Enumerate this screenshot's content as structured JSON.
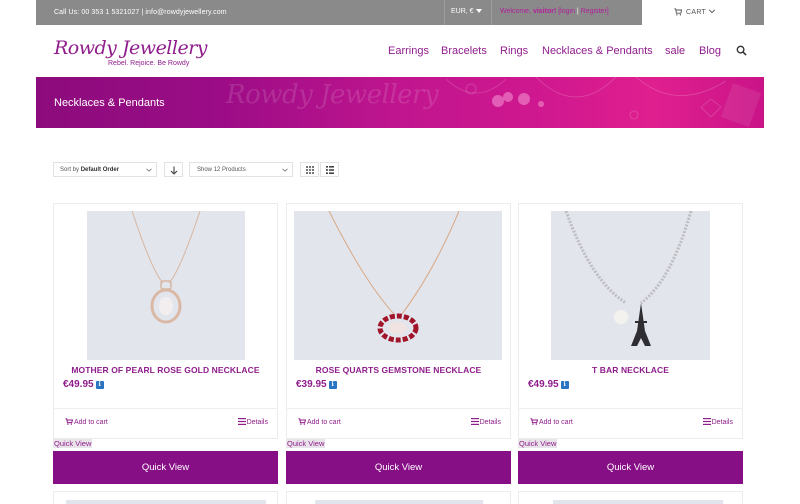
{
  "topbar": {
    "contact": "Call Us: 00 353 1 5321027  |  info@rowdyjewellery.com",
    "currency": "EUR, €",
    "welcome_prefix": "Welcome, ",
    "welcome_user": "visitor!",
    "login": "[login",
    "pipe": "|",
    "register": "Register]",
    "cart_label": "CART"
  },
  "header": {
    "logo_text": "Rowdy Jewellery",
    "tagline": "Rebel. Rejoice. Be Rowdy",
    "nav": [
      "Earrings",
      "Bracelets",
      "Rings",
      "Necklaces & Pendants",
      "sale",
      "Blog"
    ]
  },
  "banner": {
    "title": "Necklaces & Pendants",
    "watermark": "Rowdy Jewellery"
  },
  "toolbar": {
    "sort_prefix": "Sort by ",
    "sort_value": "Default Order",
    "show_prefix": "Show ",
    "show_value": "12 Products"
  },
  "products": [
    {
      "name": "MOTHER OF PEARL ROSE GOLD NECKLACE",
      "price": "€49.95",
      "add_to_cart": "Add to cart",
      "details": "Details",
      "quick_view_link": "Quick View",
      "quick_view_button": "Quick View"
    },
    {
      "name": "ROSE QUARTS GEMSTONE NECKLACE",
      "price": "€39.95",
      "add_to_cart": "Add to cart",
      "details": "Details",
      "quick_view_link": "Quick View",
      "quick_view_button": "Quick View"
    },
    {
      "name": "T BAR NECKLACE",
      "price": "€49.95",
      "add_to_cart": "Add to cart",
      "details": "Details",
      "quick_view_link": "Quick View",
      "quick_view_button": "Quick View"
    }
  ],
  "colors": {
    "brand_purple": "#8f1d8c",
    "quick_view_bg": "#870f86",
    "topbar_bg": "#8a8a8a",
    "banner_start": "#8c0b7c",
    "banner_end": "#e01f8f"
  },
  "icons": [
    "cart-icon",
    "chevron-down-icon",
    "search-icon",
    "sort-arrow-icon",
    "grid-view-icon",
    "list-view-icon",
    "info-icon",
    "details-list-icon"
  ]
}
